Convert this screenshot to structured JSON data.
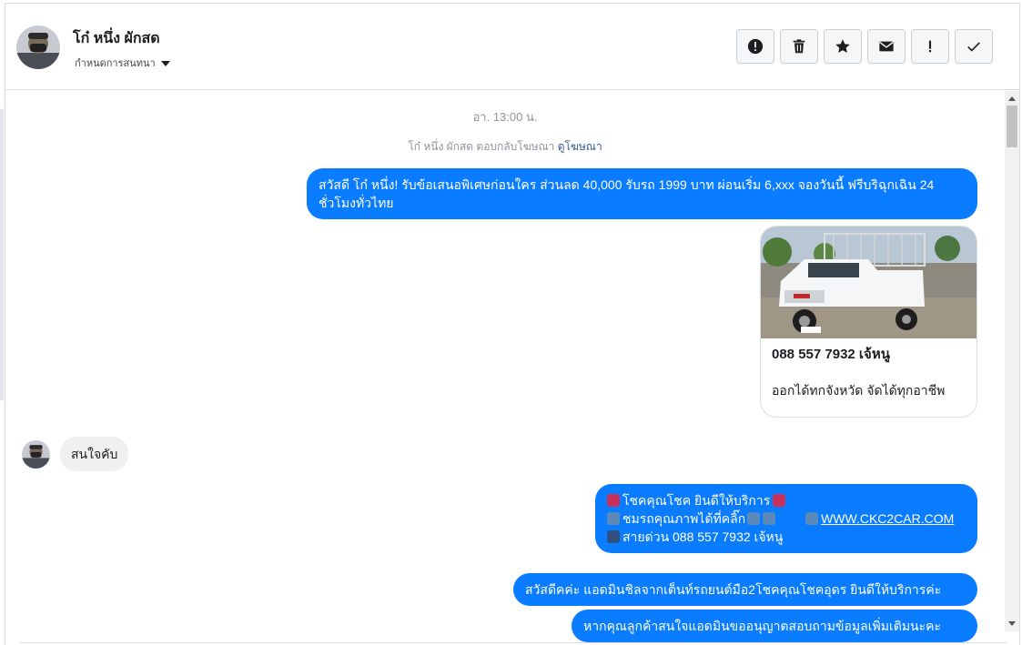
{
  "header": {
    "contact_name": "โก๋ หนึ่ง ผักสด",
    "convo_menu_label": "กำหนดการสนทนา",
    "toolbar": [
      {
        "name": "report-button",
        "icon": "alert-circle-icon"
      },
      {
        "name": "delete-button",
        "icon": "trash-icon"
      },
      {
        "name": "star-button",
        "icon": "star-icon"
      },
      {
        "name": "mark-unread-button",
        "icon": "envelope-icon"
      },
      {
        "name": "important-button",
        "icon": "exclamation-icon"
      },
      {
        "name": "done-button",
        "icon": "checkmark-icon"
      }
    ]
  },
  "thread": {
    "timestamp": "อา. 13:00 น.",
    "ad_reply_text": "โก๋ หนึ่ง ผักสด ตอบกลับโฆษณา",
    "ad_reply_link": "ดูโฆษณา",
    "messages": {
      "greeting": "สวัสดี โก๋ หนึ่ง! รับข้อเสนอพิเศษก่อนใคร ส่วนลด 40,000 รับรถ 1999 บาท ผ่อนเริ่ม 6,xxx จองวันนี้ ฟรีบริฉุกเฉิน 24 ชั่วโมงทั่วไทย",
      "ad_card_title": "088 557 7932 เจ้หนู",
      "ad_card_desc": "ออกได้ทกจังหวัด จัดได้ทุกอาชีพ",
      "incoming_reply": "สนใจคับ",
      "promo_line1": "โชคคุณโชค ยินดีให้บริการ",
      "promo_line2": "ชมรถคุณภาพได้ที่คลิ๊ก",
      "promo_link": "WWW.CKC2CAR.COM",
      "promo_line3": "สายด่วน 088 557 7932 เจ้หนู",
      "admin_greeting": "สวัสดีคค่ะ แอดมินชิลจากเต็นท์รถยนต์มือ2โชคคุณโชคอุดร ยินดีให้บริการค่ะ",
      "admin_ask": "หากคุณลูกค้าสนใจแอดมินขออนุญาตสอบถามข้อมูลเพิ่มเติมนะคะ"
    }
  },
  "colors": {
    "outgoing_bubble": "#0a7cff",
    "incoming_bubble": "#f1f0f0",
    "link": "#385898"
  }
}
